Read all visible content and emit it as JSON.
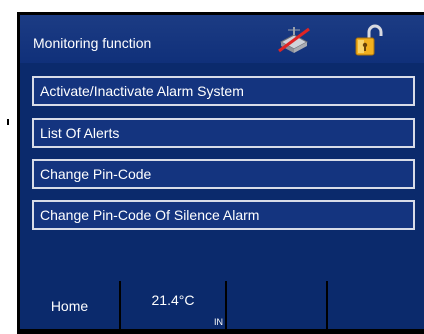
{
  "header": {
    "title": "Monitoring function",
    "icons": [
      "network-disabled-icon",
      "padlock-open-icon"
    ]
  },
  "menu": {
    "items": [
      {
        "label": "Activate/Inactivate Alarm System"
      },
      {
        "label": "List Of Alerts"
      },
      {
        "label": "Change Pin-Code"
      },
      {
        "label": "Change Pin-Code Of Silence Alarm"
      }
    ]
  },
  "footer": {
    "home_label": "Home",
    "temperature": "21.4°C",
    "temperature_source": "IN",
    "cells": 5
  },
  "colors": {
    "screen_background": "#0b2a6c",
    "button_background": "#14347f",
    "button_border": "#d8dce8",
    "text": "#ffffff"
  }
}
